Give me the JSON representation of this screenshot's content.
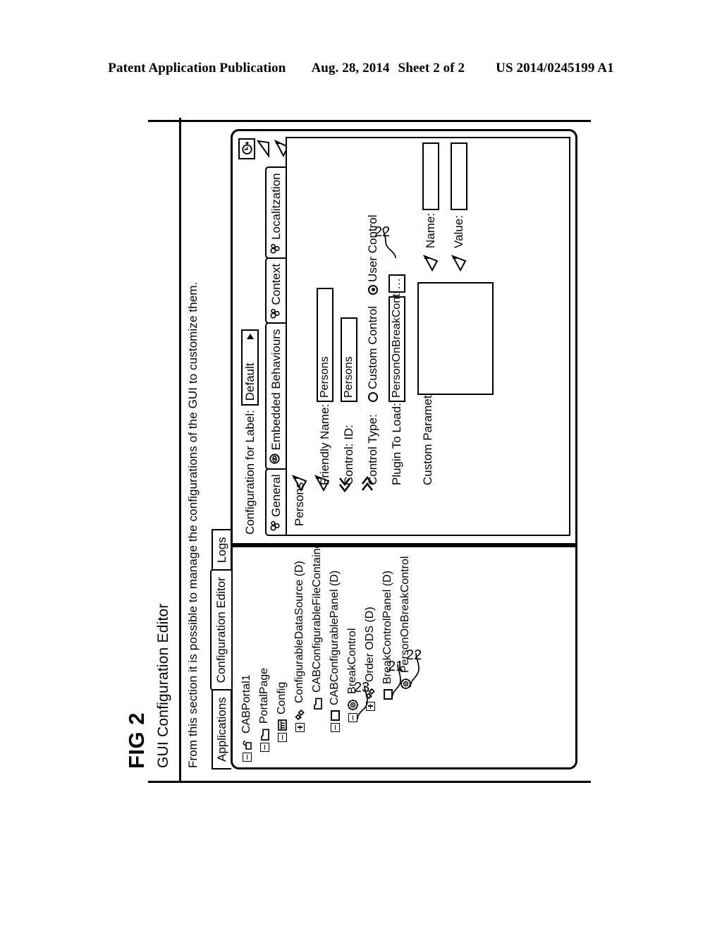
{
  "publication": {
    "left": "Patent Application Publication",
    "date": "Aug. 28, 2014",
    "sheet": "Sheet 2 of 2",
    "number": "US 2014/0245199 A1"
  },
  "figure": {
    "label": "FIG 2"
  },
  "app": {
    "title": "GUI Configuration Editor",
    "description": "From this section it is possible to manage the configurations of the GUI to customize them.",
    "tabs": [
      {
        "label": "Applications",
        "selected": false
      },
      {
        "label": "Configuration Editor",
        "selected": true
      },
      {
        "label": "Logs",
        "selected": false
      }
    ]
  },
  "tree": {
    "nodes": [
      {
        "label": "CABPortal1",
        "expander": "minus",
        "icon": "portal-icon",
        "indent": 0
      },
      {
        "label": "PortalPage",
        "expander": "minus",
        "icon": "folder-icon",
        "indent": 1
      },
      {
        "label": "Config",
        "expander": "minus",
        "icon": "grid-icon",
        "indent": 2
      },
      {
        "label": "ConfigurableDataSource (D)",
        "expander": "plus",
        "icon": "diamonds-icon",
        "indent": 3
      },
      {
        "label": "CABConfigurableFileContaine",
        "expander": "blank",
        "icon": "folder-icon",
        "indent": 4
      },
      {
        "label": "CABConfigurablePanel (D)",
        "expander": "minus",
        "icon": "square-icon",
        "indent": 3
      },
      {
        "label": "BreakControl",
        "expander": "minus",
        "icon": "gear-icon",
        "indent": 4
      },
      {
        "label": "Order ODS (D)",
        "expander": "plus",
        "icon": "diamonds-icon",
        "indent": 5
      },
      {
        "label": "BreakControlPanel (D)",
        "expander": "blank",
        "icon": "square-icon",
        "indent": 5
      },
      {
        "label": "PersonOnBreakControl",
        "expander": "blank",
        "icon": "gear-icon",
        "indent": 6
      }
    ],
    "ref_numerals": [
      {
        "value": "23"
      },
      {
        "value": "21"
      },
      {
        "value": "22"
      }
    ]
  },
  "properties": {
    "config_label_text": "Configuration for Label:",
    "config_label_value": "Default",
    "history_icon": "clock-icon",
    "tabs": [
      {
        "label": "General",
        "icon": "link-icon"
      },
      {
        "label": "Embedded Behaviours",
        "icon": "eye-icon"
      },
      {
        "label": "Context",
        "icon": "link-icon"
      },
      {
        "label": "Localitzation",
        "icon": "link-icon"
      }
    ],
    "section_title": "Persons",
    "fields": {
      "friendly_name_label": "Friendly Name:",
      "friendly_name_value": "Persons",
      "control_id_label": "Control: ID:",
      "control_id_value": "Persons",
      "control_type_label": "Control Type:",
      "control_type_options": [
        {
          "label": "Custom Control",
          "selected": false
        },
        {
          "label": "User Control",
          "selected": true
        }
      ],
      "plugin_label": "Plugin To Load:",
      "plugin_value": "PersonOnBreakControl",
      "browse_button": "...",
      "custom_params_label": "Custom Parameters:",
      "name_label": "Name:",
      "name_value": "",
      "value_label": "Value:",
      "value_value": ""
    },
    "ref_numerals": [
      {
        "value": "22"
      }
    ]
  }
}
